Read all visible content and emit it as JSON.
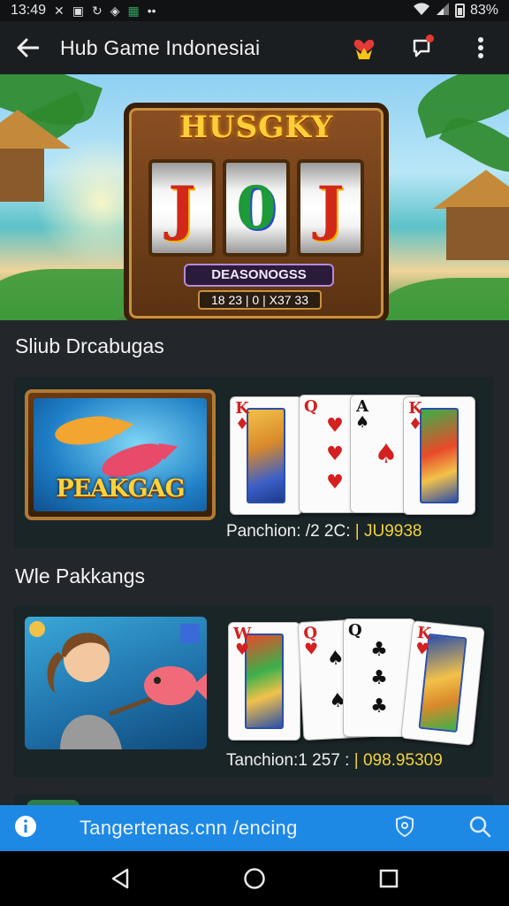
{
  "status_bar": {
    "time": "13:49",
    "battery": "83%"
  },
  "app_bar": {
    "title": "Hub Game Indonesiai"
  },
  "banner": {
    "slot_title": "HUSGKY",
    "reels": [
      "J",
      "0",
      "J"
    ],
    "plate": "DEASONOGSS",
    "counter": "18 23 | 0 | X37 33"
  },
  "sections": [
    {
      "title": "Sliub Drcabugas",
      "thumb_label": "PEAKGAG",
      "cards": [
        {
          "rank": "K",
          "suit": "♦",
          "color": "red"
        },
        {
          "rank": "Q",
          "suit": "♥",
          "color": "red"
        },
        {
          "rank": "A",
          "suit": "♠",
          "color": "black"
        },
        {
          "rank": "K",
          "suit": "♦",
          "color": "red"
        }
      ],
      "info_prefix": "Panchion: /2 2C:",
      "info_code": "JU9938"
    },
    {
      "title": "Wle Pakkangs",
      "thumb_label": "",
      "cards": [
        {
          "rank": "W",
          "suit": "♥",
          "color": "red"
        },
        {
          "rank": "Q",
          "suit": "♥",
          "color": "red"
        },
        {
          "rank": "Q",
          "suit": "♣",
          "color": "black"
        },
        {
          "rank": "K",
          "suit": "♥",
          "color": "red"
        }
      ],
      "info_prefix": "Tanchion:1 257 :",
      "info_code": "098.95309"
    }
  ],
  "url_bar": {
    "url": "Tangertenas.cnn /encing"
  },
  "colors": {
    "url_bar_bg": "#1e88e5",
    "accent_yellow": "#f2d23a",
    "card_bg": "#1a2528"
  },
  "icons": {
    "status": [
      "close-icon",
      "image-icon",
      "sync-icon",
      "shield-icon",
      "android-icon",
      "more-dots-icon",
      "wifi-icon",
      "signal-icon",
      "battery-icon"
    ],
    "app_bar": [
      "back-arrow-icon",
      "heart-crown-icon",
      "chat-notification-icon",
      "more-vert-icon"
    ],
    "url_bar": [
      "info-icon",
      "shield-icon",
      "search-icon"
    ],
    "nav": [
      "back-triangle-icon",
      "home-circle-icon",
      "recents-square-icon"
    ]
  }
}
